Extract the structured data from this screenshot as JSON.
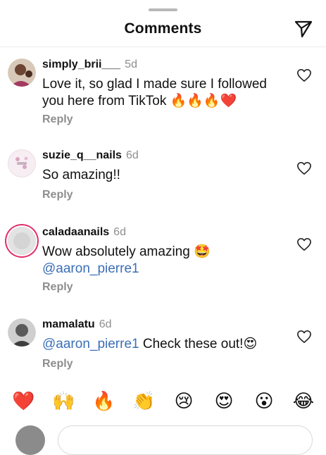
{
  "header": {
    "title": "Comments",
    "send_icon": "paper-plane-icon"
  },
  "comments": [
    {
      "username": "simply_brii___",
      "age": "5d",
      "text": "Love it, so glad I made sure I followed you here from TikTok 🔥🔥🔥❤️",
      "reply_label": "Reply",
      "avatar_icon": "user-photo-avatar",
      "like_icon": "heart-outline-icon"
    },
    {
      "username": "suzie_q__nails",
      "age": "6d",
      "text": "So amazing!!",
      "reply_label": "Reply",
      "avatar_icon": "floral-logo-avatar",
      "like_icon": "heart-outline-icon"
    },
    {
      "username": "caladaanails",
      "age": "6d",
      "text": "Wow absolutely amazing 🤩",
      "mention": "@aaron_pierre1",
      "reply_label": "Reply",
      "avatar_icon": "story-ring-avatar",
      "like_icon": "heart-outline-icon"
    },
    {
      "username": "mamalatu",
      "age": "6d",
      "mention": "@aaron_pierre1",
      "text": " Check these out!😍",
      "reply_label": "Reply",
      "avatar_icon": "user-photo-avatar",
      "like_icon": "heart-outline-icon"
    }
  ],
  "emoji_bar": [
    "❤️",
    "🙌",
    "🔥",
    "👏",
    "😢",
    "😍",
    "😮",
    "😂"
  ],
  "colors": {
    "mention": "#3b6fb6",
    "muted": "#8e8e8e",
    "ring": "#e1306c"
  }
}
